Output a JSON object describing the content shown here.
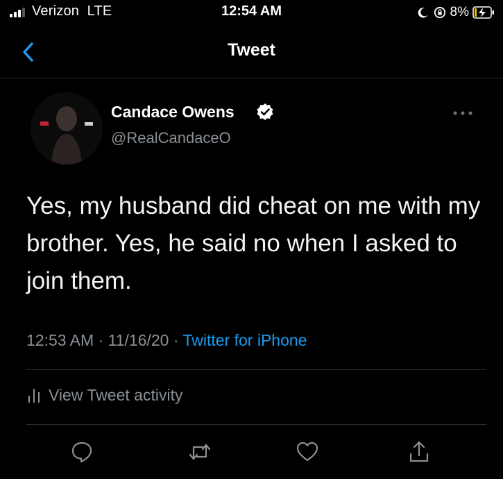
{
  "status_bar": {
    "carrier": "Verizon",
    "network": "LTE",
    "time": "12:54 AM",
    "battery_percent": "8%"
  },
  "nav": {
    "title": "Tweet",
    "back_icon": "chevron-left-icon"
  },
  "tweet": {
    "author_name": "Candace Owens",
    "handle": "@RealCandaceO",
    "verified": true,
    "text": "Yes, my husband did cheat on me with my brother. Yes, he said no when I asked to join them.",
    "time": "12:53 AM",
    "date": "11/16/20",
    "source": "Twitter for iPhone",
    "separator": " · "
  },
  "activity": {
    "label": "View Tweet activity"
  },
  "actions": [
    "reply-icon",
    "retweet-icon",
    "like-icon",
    "share-icon"
  ],
  "colors": {
    "background": "#000000",
    "text": "#ffffff",
    "secondary": "#8b9196",
    "accent": "#1d9bf0"
  }
}
